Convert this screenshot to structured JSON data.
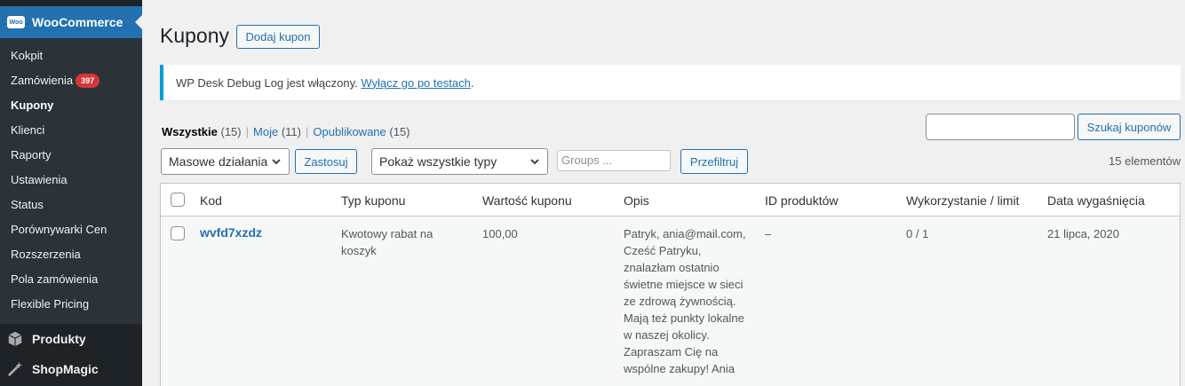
{
  "sidebar": {
    "header": {
      "logo_text": "Woo",
      "title": "WooCommerce"
    },
    "items": [
      {
        "label": "Kokpit"
      },
      {
        "label": "Zamówienia",
        "badge": "397"
      },
      {
        "label": "Kupony"
      },
      {
        "label": "Klienci"
      },
      {
        "label": "Raporty"
      },
      {
        "label": "Ustawienia"
      },
      {
        "label": "Status"
      },
      {
        "label": "Porównywarki Cen"
      },
      {
        "label": "Rozszerzenia"
      },
      {
        "label": "Pola zamówienia"
      },
      {
        "label": "Flexible Pricing"
      }
    ],
    "top_items": [
      {
        "label": "Produkty",
        "icon": "box-icon"
      },
      {
        "label": "ShopMagic",
        "icon": "magic-wand-icon"
      }
    ]
  },
  "header": {
    "title": "Kupony",
    "add_button": "Dodaj kupon"
  },
  "notice": {
    "text": "WP Desk Debug Log jest włączony. ",
    "link": "Wyłącz go po testach",
    "suffix": "."
  },
  "views": [
    {
      "label": "Wszystkie",
      "count": "(15)"
    },
    {
      "label": "Moje",
      "count": "(11)"
    },
    {
      "label": "Opublikowane",
      "count": "(15)"
    }
  ],
  "search": {
    "value": "",
    "button": "Szukaj kuponów"
  },
  "filters": {
    "bulk_action": "Masowe działania",
    "apply": "Zastosuj",
    "type_select": "Pokaż wszystkie typy",
    "groups_placeholder": "Groups ...",
    "filter_button": "Przefiltruj",
    "items_count": "15 elementów"
  },
  "table": {
    "columns": [
      "Kod",
      "Typ kuponu",
      "Wartość kuponu",
      "Opis",
      "ID produktów",
      "Wykorzystanie / limit",
      "Data wygaśnięcia"
    ],
    "rows": [
      {
        "code": "wvfd7xzdz",
        "type_line1": "Kwotowy rabat na",
        "type_line2": "koszyk",
        "value": "100,00",
        "desc": [
          "Patryk, ania@mail.com,",
          "Cześć Patryku,",
          "znalazłam ostatnio",
          "świetne miejsce w sieci",
          "ze zdrową żywnością.",
          "Mają też punkty lokalne",
          "w naszej okolicy.",
          "Zapraszam Cię na",
          "wspólne zakupy! Ania"
        ],
        "product_ids": "–",
        "usage": "0 / 1",
        "expiry": "21 lipca, 2020"
      }
    ]
  }
}
